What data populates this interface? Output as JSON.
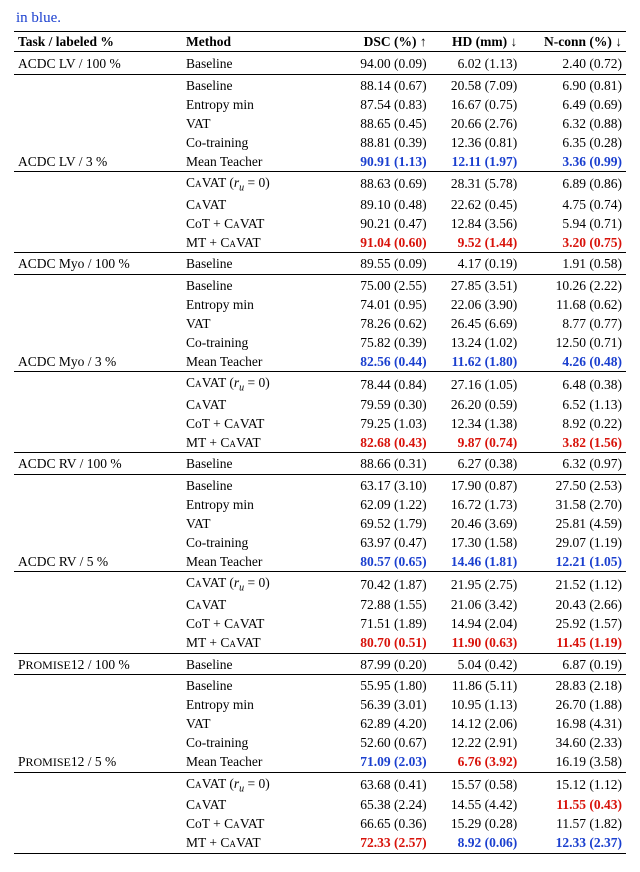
{
  "pretext": "in blue.",
  "headers": {
    "task": "Task / labeled %",
    "method": "Method",
    "dsc": "DSC (%) ↑",
    "hd": "HD (mm) ↓",
    "nconn": "N-conn (%) ↓"
  },
  "methods": {
    "baseline": "Baseline",
    "entropy": "Entropy min",
    "vat": "VAT",
    "cotrain": "Co-training",
    "mt": "Mean Teacher",
    "cavat0_pre": "C",
    "cavat0_sc": "a",
    "cavat0_post": "VAT (",
    "cavat0_var": "r",
    "cavat0_sub": "u",
    "cavat0_eq": " = 0)",
    "cavat_pre": "C",
    "cavat_sc": "a",
    "cavat_post": "VAT",
    "cot_cavat_pre": "CoT + C",
    "cot_cavat_sc": "a",
    "cot_cavat_post": "VAT",
    "mt_cavat_pre": "MT + C",
    "mt_cavat_sc": "a",
    "mt_cavat_post": "VAT"
  },
  "chart_data": {
    "type": "table",
    "columns": [
      "Task / labeled %",
      "Method",
      "DSC (%) ↑",
      "HD (mm) ↓",
      "N-conn (%) ↓"
    ],
    "groups": [
      {
        "task": "ACDC LV / 100 %",
        "rows": [
          {
            "method": "Baseline",
            "dsc": "94.00 (0.09)",
            "hd": "6.02 (1.13)",
            "nconn": "2.40 (0.72)"
          }
        ]
      },
      {
        "task": "ACDC LV / 3 %",
        "rows": [
          {
            "method": "Baseline",
            "dsc": "88.14 (0.67)",
            "hd": "20.58 (7.09)",
            "nconn": "6.90 (0.81)"
          },
          {
            "method": "Entropy min",
            "dsc": "87.54 (0.83)",
            "hd": "16.67 (0.75)",
            "nconn": "6.49 (0.69)"
          },
          {
            "method": "VAT",
            "dsc": "88.65 (0.45)",
            "hd": "20.66 (2.76)",
            "nconn": "6.32 (0.88)"
          },
          {
            "method": "Co-training",
            "dsc": "88.81 (0.39)",
            "hd": "12.36 (0.81)",
            "nconn": "6.35 (0.28)"
          },
          {
            "method": "Mean Teacher",
            "dsc": "90.91 (1.13)",
            "hd": "12.11 (1.97)",
            "nconn": "3.36 (0.99)",
            "hl": {
              "dsc": "blue",
              "hd": "blue",
              "nconn": "blue"
            }
          }
        ],
        "rows2": [
          {
            "method": "CAVAT (r_u=0)",
            "dsc": "88.63 (0.69)",
            "hd": "28.31 (5.78)",
            "nconn": "6.89 (0.86)"
          },
          {
            "method": "CAVAT",
            "dsc": "89.10 (0.48)",
            "hd": "22.62 (0.45)",
            "nconn": "4.75 (0.74)"
          },
          {
            "method": "CoT + CAVAT",
            "dsc": "90.21 (0.47)",
            "hd": "12.84 (3.56)",
            "nconn": "5.94 (0.71)"
          },
          {
            "method": "MT + CAVAT",
            "dsc": "91.04 (0.60)",
            "hd": "9.52 (1.44)",
            "nconn": "3.20 (0.75)",
            "hl": {
              "dsc": "red",
              "hd": "red",
              "nconn": "red"
            }
          }
        ]
      },
      {
        "task": "ACDC Myo / 100 %",
        "rows": [
          {
            "method": "Baseline",
            "dsc": "89.55 (0.09)",
            "hd": "4.17 (0.19)",
            "nconn": "1.91 (0.58)"
          }
        ]
      },
      {
        "task": "ACDC Myo / 3 %",
        "rows": [
          {
            "method": "Baseline",
            "dsc": "75.00 (2.55)",
            "hd": "27.85 (3.51)",
            "nconn": "10.26 (2.22)"
          },
          {
            "method": "Entropy min",
            "dsc": "74.01 (0.95)",
            "hd": "22.06 (3.90)",
            "nconn": "11.68 (0.62)"
          },
          {
            "method": "VAT",
            "dsc": "78.26 (0.62)",
            "hd": "26.45 (6.69)",
            "nconn": "8.77 (0.77)"
          },
          {
            "method": "Co-training",
            "dsc": "75.82 (0.39)",
            "hd": "13.24 (1.02)",
            "nconn": "12.50 (0.71)"
          },
          {
            "method": "Mean Teacher",
            "dsc": "82.56 (0.44)",
            "hd": "11.62 (1.80)",
            "nconn": "4.26 (0.48)",
            "hl": {
              "dsc": "blue",
              "hd": "blue",
              "nconn": "blue"
            }
          }
        ],
        "rows2": [
          {
            "method": "CAVAT (r_u=0)",
            "dsc": "78.44 (0.84)",
            "hd": "27.16 (1.05)",
            "nconn": "6.48 (0.38)"
          },
          {
            "method": "CAVAT",
            "dsc": "79.59 (0.30)",
            "hd": "26.20 (0.59)",
            "nconn": "6.52 (1.13)"
          },
          {
            "method": "CoT + CAVAT",
            "dsc": "79.25 (1.03)",
            "hd": "12.34 (1.38)",
            "nconn": "8.92 (0.22)"
          },
          {
            "method": "MT + CAVAT",
            "dsc": "82.68 (0.43)",
            "hd": "9.87 (0.74)",
            "nconn": "3.82 (1.56)",
            "hl": {
              "dsc": "red",
              "hd": "red",
              "nconn": "red"
            }
          }
        ]
      },
      {
        "task": "ACDC RV / 100 %",
        "rows": [
          {
            "method": "Baseline",
            "dsc": "88.66 (0.31)",
            "hd": "6.27 (0.38)",
            "nconn": "6.32 (0.97)"
          }
        ]
      },
      {
        "task": "ACDC RV / 5 %",
        "rows": [
          {
            "method": "Baseline",
            "dsc": "63.17 (3.10)",
            "hd": "17.90 (0.87)",
            "nconn": "27.50 (2.53)"
          },
          {
            "method": "Entropy min",
            "dsc": "62.09 (1.22)",
            "hd": "16.72 (1.73)",
            "nconn": "31.58 (2.70)"
          },
          {
            "method": "VAT",
            "dsc": "69.52 (1.79)",
            "hd": "20.46 (3.69)",
            "nconn": "25.81 (4.59)"
          },
          {
            "method": "Co-training",
            "dsc": "63.97 (0.47)",
            "hd": "17.30 (1.58)",
            "nconn": "29.07 (1.19)"
          },
          {
            "method": "Mean Teacher",
            "dsc": "80.57 (0.65)",
            "hd": "14.46 (1.81)",
            "nconn": "12.21 (1.05)",
            "hl": {
              "dsc": "blue",
              "hd": "blue",
              "nconn": "blue"
            }
          }
        ],
        "rows2": [
          {
            "method": "CAVAT (r_u=0)",
            "dsc": "70.42 (1.87)",
            "hd": "21.95 (2.75)",
            "nconn": "21.52 (1.12)"
          },
          {
            "method": "CAVAT",
            "dsc": "72.88 (1.55)",
            "hd": "21.06 (3.42)",
            "nconn": "20.43 (2.66)"
          },
          {
            "method": "CoT + CAVAT",
            "dsc": "71.51 (1.89)",
            "hd": "14.94 (2.04)",
            "nconn": "25.92 (1.57)"
          },
          {
            "method": "MT + CAVAT",
            "dsc": "80.70 (0.51)",
            "hd": "11.90 (0.63)",
            "nconn": "11.45 (1.19)",
            "hl": {
              "dsc": "red",
              "hd": "red",
              "nconn": "red"
            }
          }
        ]
      },
      {
        "task": "PROMISE12 / 100 %",
        "sc": true,
        "rows": [
          {
            "method": "Baseline",
            "dsc": "87.99 (0.20)",
            "hd": "5.04 (0.42)",
            "nconn": "6.87 (0.19)"
          }
        ]
      },
      {
        "task": "PROMISE12 / 5 %",
        "sc": true,
        "rows": [
          {
            "method": "Baseline",
            "dsc": "55.95 (1.80)",
            "hd": "11.86 (5.11)",
            "nconn": "28.83 (2.18)"
          },
          {
            "method": "Entropy min",
            "dsc": "56.39 (3.01)",
            "hd": "10.95 (1.13)",
            "nconn": "26.70 (1.88)"
          },
          {
            "method": "VAT",
            "dsc": "62.89 (4.20)",
            "hd": "14.12 (2.06)",
            "nconn": "16.98 (4.31)"
          },
          {
            "method": "Co-training",
            "dsc": "52.60 (0.67)",
            "hd": "12.22 (2.91)",
            "nconn": "34.60 (2.33)"
          },
          {
            "method": "Mean Teacher",
            "dsc": "71.09 (2.03)",
            "hd": "6.76 (3.92)",
            "nconn": "16.19 (3.58)",
            "hl": {
              "dsc": "blue",
              "hd": "red"
            }
          }
        ],
        "rows2": [
          {
            "method": "CAVAT (r_u=0)",
            "dsc": "63.68 (0.41)",
            "hd": "15.57 (0.58)",
            "nconn": "15.12 (1.12)"
          },
          {
            "method": "CAVAT",
            "dsc": "65.38 (2.24)",
            "hd": "14.55 (4.42)",
            "nconn": "11.55 (0.43)",
            "hl": {
              "nconn": "red"
            }
          },
          {
            "method": "CoT + CAVAT",
            "dsc": "66.65 (0.36)",
            "hd": "15.29 (0.28)",
            "nconn": "11.57 (1.82)"
          },
          {
            "method": "MT + CAVAT",
            "dsc": "72.33 (2.57)",
            "hd": "8.92 (0.06)",
            "nconn": "12.33 (2.37)",
            "hl": {
              "dsc": "red",
              "hd": "blue",
              "nconn": "blue"
            }
          }
        ]
      }
    ]
  }
}
